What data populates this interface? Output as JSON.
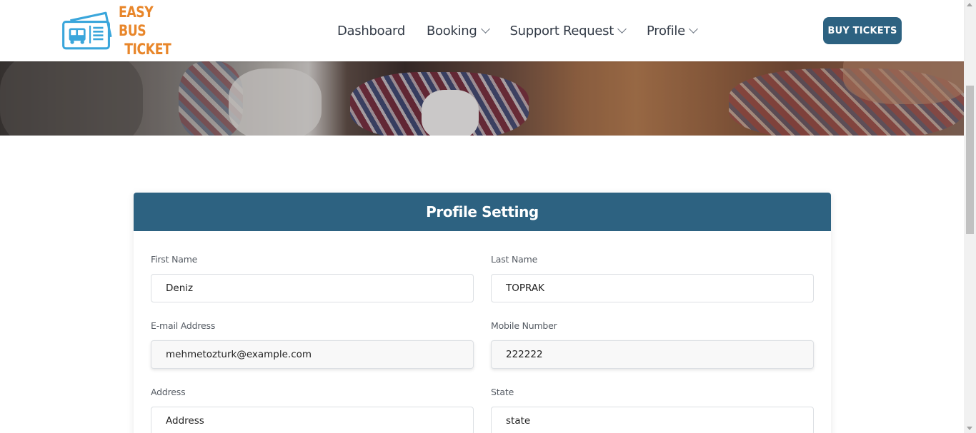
{
  "brand": {
    "name_line1": "EASY BUS",
    "name_line2": "TICKET",
    "logo_icon": "bus-ticket-icon",
    "color_primary": "#2d6281",
    "color_accent": "#e8862a",
    "color_icon": "#3aa6db"
  },
  "nav": {
    "items": [
      {
        "label": "Dashboard",
        "dropdown": false
      },
      {
        "label": "Booking",
        "dropdown": true
      },
      {
        "label": "Support Request",
        "dropdown": true
      },
      {
        "label": "Profile",
        "dropdown": true
      }
    ],
    "buy_label": "BUY TICKETS"
  },
  "profile": {
    "title": "Profile Setting",
    "fields": {
      "first_name": {
        "label": "First Name",
        "value": "Deniz"
      },
      "last_name": {
        "label": "Last Name",
        "value": "TOPRAK"
      },
      "email": {
        "label": "E-mail Address",
        "value": "mehmetozturk@example.com"
      },
      "mobile": {
        "label": "Mobile Number",
        "value": "222222"
      },
      "address": {
        "label": "Address",
        "placeholder": "Address"
      },
      "state": {
        "label": "State",
        "placeholder": "state"
      }
    }
  }
}
